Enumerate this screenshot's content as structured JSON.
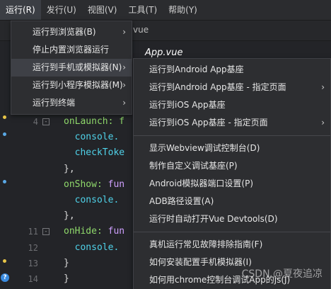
{
  "menubar": {
    "items": [
      {
        "label": "运行(R)",
        "active": true
      },
      {
        "label": "发行(U)"
      },
      {
        "label": "视图(V)"
      },
      {
        "label": "工具(T)"
      },
      {
        "label": "帮助(Y)"
      }
    ]
  },
  "tab_fragment": "vue",
  "file_title": "App.vue",
  "run_menu": {
    "items": [
      {
        "label": "运行到浏览器(B)",
        "submenu": true
      },
      {
        "label": "停止内置浏览器运行",
        "submenu": false
      },
      {
        "label": "运行到手机或模拟器(N)",
        "submenu": true,
        "hover": true
      },
      {
        "label": "运行到小程序模拟器(M)",
        "submenu": true
      },
      {
        "label": "运行到终端",
        "submenu": true
      }
    ]
  },
  "device_submenu": {
    "groups": [
      [
        {
          "label": "运行到Android App基座",
          "submenu": false
        },
        {
          "label": "运行到Android App基座 - 指定页面",
          "submenu": true
        },
        {
          "label": "运行到iOS App基座",
          "submenu": false
        },
        {
          "label": "运行到iOS App基座 - 指定页面",
          "submenu": true
        }
      ],
      [
        {
          "label": "显示Webview调试控制台(D)"
        },
        {
          "label": "制作自定义调试基座(P)"
        },
        {
          "label": "Android模拟器端口设置(P)"
        },
        {
          "label": "ADB路径设置(A)"
        },
        {
          "label": "运行时自动打开Vue Devtools(D)"
        }
      ],
      [
        {
          "label": "真机运行常见故障排除指南(F)"
        },
        {
          "label": "如何安装配置手机模拟器(I)"
        },
        {
          "label": "如何用chrome控制台调试App的js(J)"
        }
      ]
    ]
  },
  "code_lines": [
    {
      "num": "4",
      "fold": "-",
      "parts": [
        {
          "t": "onLaunch: f",
          "c": "c-key"
        }
      ]
    },
    {
      "num": "",
      "fold": "",
      "parts": [
        {
          "t": "  console.",
          "c": "c-obj"
        }
      ]
    },
    {
      "num": "",
      "fold": "",
      "parts": [
        {
          "t": "  checkToke",
          "c": "c-obj"
        }
      ]
    },
    {
      "num": "",
      "fold": "",
      "parts": [
        {
          "t": "},",
          "c": "c-punct"
        }
      ]
    },
    {
      "num": "",
      "fold": "",
      "parts": [
        {
          "t": "onShow: ",
          "c": "c-key"
        },
        {
          "t": "fun",
          "c": "c-fn"
        }
      ]
    },
    {
      "num": "",
      "fold": "",
      "parts": [
        {
          "t": "  console.",
          "c": "c-obj"
        }
      ]
    },
    {
      "num": "",
      "fold": "",
      "parts": [
        {
          "t": "},",
          "c": "c-punct"
        }
      ]
    },
    {
      "num": "11",
      "fold": "-",
      "parts": [
        {
          "t": "onHide: ",
          "c": "c-key"
        },
        {
          "t": "fun",
          "c": "c-fn"
        }
      ]
    },
    {
      "num": "12",
      "fold": "",
      "parts": [
        {
          "t": "  console.",
          "c": "c-obj"
        }
      ]
    },
    {
      "num": "13",
      "fold": "",
      "parts": [
        {
          "t": "}",
          "c": "c-punct"
        }
      ]
    },
    {
      "num": "14",
      "fold": "",
      "parts": [
        {
          "t": "}",
          "c": "c-punct"
        }
      ]
    }
  ],
  "watermark": "CSDN @夏夜追凉",
  "help_glyph": "?",
  "colors": {
    "menu_bg": "#2d2e31",
    "menu_hover": "#3e4046",
    "editor_bg": "#232428"
  }
}
